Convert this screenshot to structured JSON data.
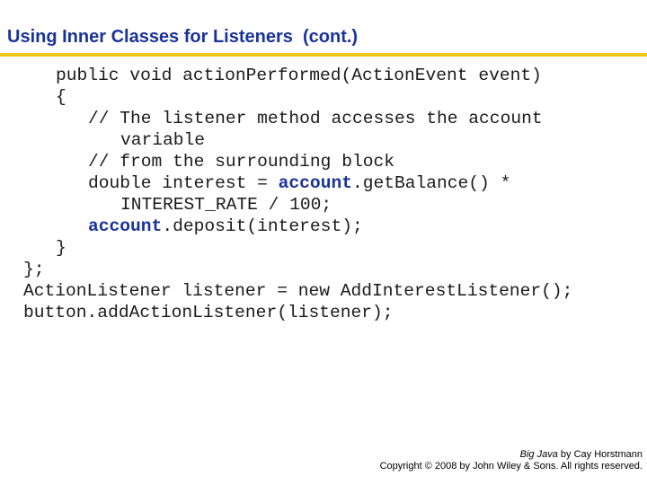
{
  "slide": {
    "title": "Using Inner Classes for Listeners  (cont.)",
    "accent_color": "#f5c518",
    "title_color": "#1a3399"
  },
  "code": {
    "lines": [
      {
        "indent": 3,
        "segments": [
          {
            "text": "public void actionPerformed(ActionEvent event)",
            "bold": false
          }
        ]
      },
      {
        "indent": 3,
        "segments": [
          {
            "text": "{",
            "bold": false
          }
        ]
      },
      {
        "indent": 6,
        "segments": [
          {
            "text": "// The listener method accesses the account",
            "bold": false
          }
        ]
      },
      {
        "indent": 9,
        "segments": [
          {
            "text": "variable",
            "bold": false
          }
        ]
      },
      {
        "indent": 6,
        "segments": [
          {
            "text": "// from the surrounding block",
            "bold": false
          }
        ]
      },
      {
        "indent": 6,
        "segments": [
          {
            "text": "double interest = ",
            "bold": false
          },
          {
            "text": "account",
            "bold": true
          },
          {
            "text": ".getBalance() *",
            "bold": false
          }
        ]
      },
      {
        "indent": 9,
        "segments": [
          {
            "text": "INTEREST_RATE / 100;",
            "bold": false
          }
        ]
      },
      {
        "indent": 6,
        "segments": [
          {
            "text": "account",
            "bold": true
          },
          {
            "text": ".deposit(interest);",
            "bold": false
          }
        ]
      },
      {
        "indent": 3,
        "segments": [
          {
            "text": "}",
            "bold": false
          }
        ]
      },
      {
        "indent": 0,
        "segments": [
          {
            "text": "};",
            "bold": false
          }
        ]
      },
      {
        "indent": 0,
        "segments": [
          {
            "text": "ActionListener listener = new AddInterestListener();",
            "bold": false
          }
        ]
      },
      {
        "indent": 0,
        "segments": [
          {
            "text": "button.addActionListener(listener);",
            "bold": false
          }
        ]
      }
    ]
  },
  "footer": {
    "book_title": "Big Java",
    "byline": " by Cay Horstmann",
    "copyright": "Copyright © 2008 by John Wiley & Sons.  All rights reserved."
  }
}
